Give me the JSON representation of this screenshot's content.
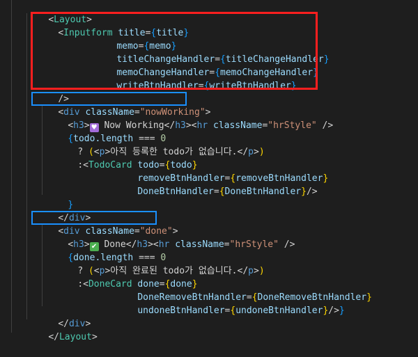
{
  "colors": {
    "background": "#1e1e1e",
    "inputform_box": "#ff1f1f",
    "div_box": "#1a90ff",
    "tag": "#569cd6",
    "component": "#4ec9b0",
    "attribute": "#9cdcfe",
    "string": "#ce9178",
    "number": "#b5cea8",
    "bracket_level1": "#ffd700",
    "bracket_level2": "#da70d6",
    "bracket_level3": "#179fff"
  },
  "icons": {
    "heart": "purple-heart-icon",
    "check": "check-mark-icon"
  },
  "code": {
    "layout_open": "Layout",
    "inputform": {
      "component": "Inputform",
      "title_attr": "title",
      "title_value": "title",
      "memo_attr": "memo",
      "memo_value": "memo",
      "title_change_attr": "titleChangeHandler",
      "title_change_value": "titleChangeHandler",
      "memo_change_attr": "memoChangeHandler",
      "memo_change_value": "memoChangeHandler",
      "write_btn_attr": "writeBtnHandler",
      "write_btn_value": "writeBtnHandler",
      "self_close": "/>"
    },
    "now_working": {
      "tag": "div",
      "class_attr": "className",
      "class_value": "\"nowWorking\"",
      "h3_tag": "h3",
      "heading_text": "Now Working",
      "hr_tag": "hr",
      "hr_class_value": "\"hrStyle\"",
      "condition_var": "todo",
      "condition_prop": ".length",
      "condition_op": " === ",
      "condition_num": "0",
      "p_tag": "p",
      "empty_message": "아직 등록한 todo가 없습니다.",
      "card_component": "TodoCard",
      "card_prop_attr": "todo",
      "card_prop_value": "todo",
      "remove_attr": "removeBtnHandler",
      "remove_value": "removeBtnHandler",
      "done_attr": "DoneBtnHandler",
      "done_value": "DoneBtnHandler"
    },
    "done": {
      "tag": "div",
      "class_attr": "className",
      "class_value": "\"done\"",
      "h3_tag": "h3",
      "heading_text": "Done",
      "hr_tag": "hr",
      "hr_class_value": "\"hrStyle\"",
      "condition_var": "done",
      "condition_prop": ".length",
      "condition_op": " === ",
      "condition_num": "0",
      "p_tag": "p",
      "empty_message": "아직 완료된 todo가 없습니다.",
      "card_component": "DoneCard",
      "card_prop_attr": "done",
      "card_prop_value": "done",
      "remove_attr": "DoneRemoveBtnHandler",
      "remove_value": "DoneRemoveBtnHandler",
      "undone_attr": "undoneBtnHandler",
      "undone_value": "undoneBtnHandler"
    },
    "layout_close": "Layout"
  }
}
